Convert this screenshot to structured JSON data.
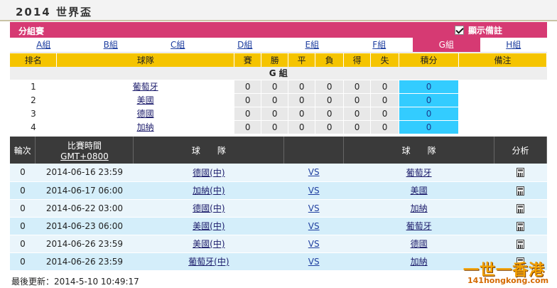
{
  "page_title": "2014 世界盃",
  "stage": {
    "label": "分組賽",
    "remark_toggle_label": "顯示備註",
    "remark_checked": true
  },
  "group_tabs": [
    "A組",
    "B組",
    "C組",
    "D組",
    "E組",
    "F組",
    "G組",
    "H組"
  ],
  "active_group_index": 6,
  "standings": {
    "headers": [
      "排名",
      "球隊",
      "賽",
      "勝",
      "平",
      "負",
      "得",
      "失",
      "積分",
      "備注"
    ],
    "group_label": "G 組",
    "rows": [
      {
        "rank": "1",
        "team": "葡萄牙",
        "p": "0",
        "w": "0",
        "d": "0",
        "l": "0",
        "gf": "0",
        "ga": "0",
        "pts": "0"
      },
      {
        "rank": "2",
        "team": "美國",
        "p": "0",
        "w": "0",
        "d": "0",
        "l": "0",
        "gf": "0",
        "ga": "0",
        "pts": "0"
      },
      {
        "rank": "3",
        "team": "德國",
        "p": "0",
        "w": "0",
        "d": "0",
        "l": "0",
        "gf": "0",
        "ga": "0",
        "pts": "0"
      },
      {
        "rank": "4",
        "team": "加納",
        "p": "0",
        "w": "0",
        "d": "0",
        "l": "0",
        "gf": "0",
        "ga": "0",
        "pts": "0"
      }
    ]
  },
  "matches": {
    "headers": {
      "round": "輪次",
      "time": "比賽時間",
      "timezone": "GMT+0800",
      "home": "球　　隊",
      "away": "球　　隊",
      "analysis": "分析"
    },
    "rows": [
      {
        "round": "0",
        "time": "2014-06-16 23:59",
        "home": "德國(中)",
        "vs": "VS",
        "away": "葡萄牙"
      },
      {
        "round": "0",
        "time": "2014-06-17 06:00",
        "home": "加納(中)",
        "vs": "VS",
        "away": "美國"
      },
      {
        "round": "0",
        "time": "2014-06-22 03:00",
        "home": "德國(中)",
        "vs": "VS",
        "away": "加納"
      },
      {
        "round": "0",
        "time": "2014-06-23 06:00",
        "home": "美國(中)",
        "vs": "VS",
        "away": "葡萄牙"
      },
      {
        "round": "0",
        "time": "2014-06-26 23:59",
        "home": "美國(中)",
        "vs": "VS",
        "away": "德國"
      },
      {
        "round": "0",
        "time": "2014-06-26 23:59",
        "home": "葡萄牙(中)",
        "vs": "VS",
        "away": "加納"
      }
    ],
    "analysis_icon": "calculator-icon"
  },
  "footer": {
    "last_update": "最後更新：2014-5-10 10:49:17"
  },
  "watermark": {
    "text": "一世一香港",
    "url": "141hongkong.com"
  },
  "colors": {
    "accent": "#d63a73",
    "header_yellow": "#f5c400",
    "points_cyan": "#33ccff",
    "dark_header": "#3a3a3a"
  }
}
